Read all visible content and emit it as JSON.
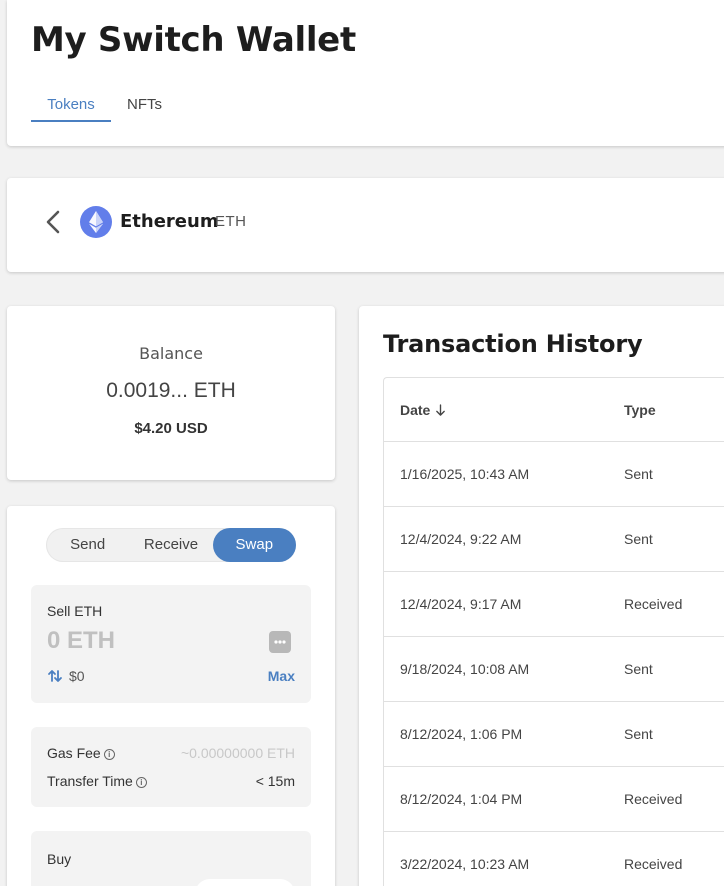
{
  "header": {
    "title": "My Switch Wallet",
    "tabs": [
      {
        "label": "Tokens",
        "active": true
      },
      {
        "label": "NFTs",
        "active": false
      }
    ]
  },
  "token": {
    "name": "Ethereum",
    "symbol": "ETH",
    "logo_color": "#627eea"
  },
  "balance": {
    "label": "Balance",
    "amount": "0.0019... ETH",
    "usd": "$4.20 USD"
  },
  "actions": {
    "tabs": [
      "Send",
      "Receive",
      "Swap"
    ],
    "active": "Swap",
    "accent_color": "#4a7fc1"
  },
  "sell": {
    "label": "Sell ETH",
    "placeholder": "0 ETH",
    "usd": "$0",
    "max_label": "Max"
  },
  "fees": {
    "gas_label": "Gas Fee",
    "gas_value": "~0.00000000 ETH",
    "time_label": "Transfer Time",
    "time_value": "< 15m"
  },
  "buy": {
    "label": "Buy"
  },
  "history": {
    "title": "Transaction History",
    "columns": [
      "Date",
      "Type"
    ],
    "rows": [
      {
        "date": "1/16/2025, 10:43 AM",
        "type": "Sent"
      },
      {
        "date": "12/4/2024, 9:22 AM",
        "type": "Sent"
      },
      {
        "date": "12/4/2024, 9:17 AM",
        "type": "Received"
      },
      {
        "date": "9/18/2024, 10:08 AM",
        "type": "Sent"
      },
      {
        "date": "8/12/2024, 1:06 PM",
        "type": "Sent"
      },
      {
        "date": "8/12/2024, 1:04 PM",
        "type": "Received"
      },
      {
        "date": "3/22/2024, 10:23 AM",
        "type": "Received"
      }
    ]
  }
}
